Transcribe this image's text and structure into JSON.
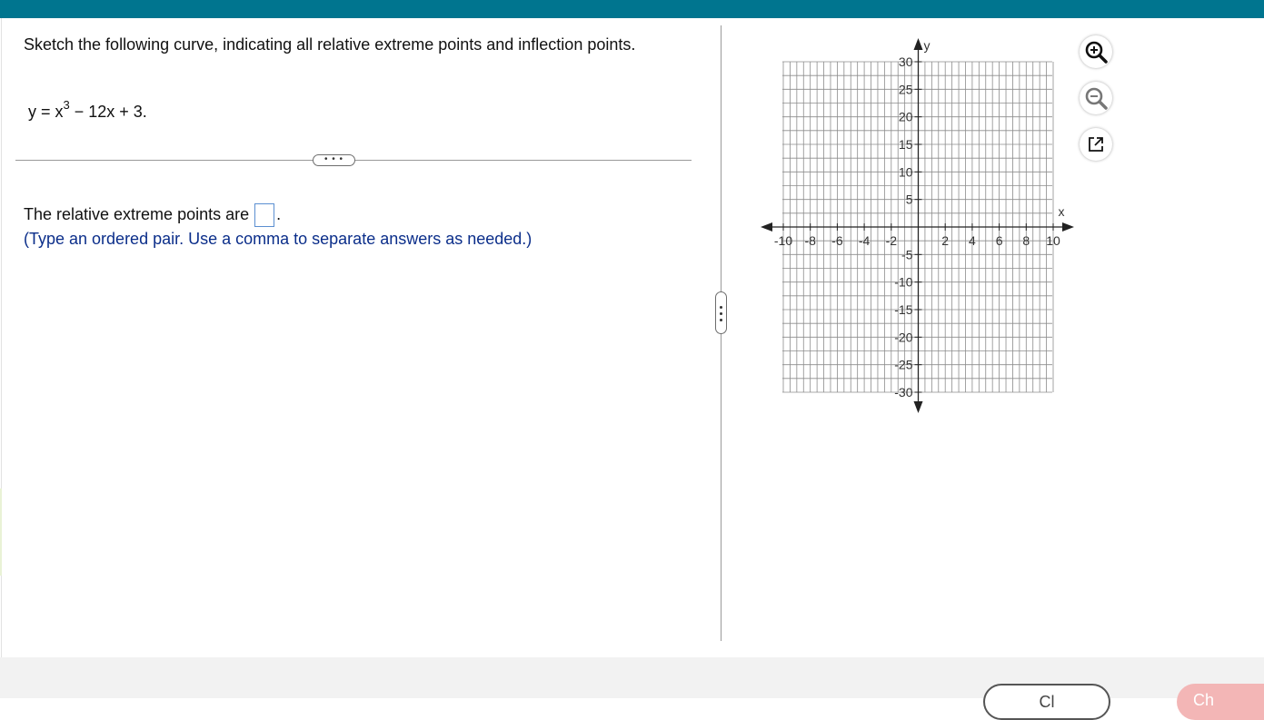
{
  "question": {
    "prompt": "Sketch the following curve, indicating all relative extreme points and inflection points.",
    "equation_prefix": "y = x",
    "equation_exp": "3",
    "equation_suffix": " − 12x + 3."
  },
  "expand_label": "• • •",
  "answer": {
    "label": "The relative extreme points are",
    "value": "",
    "after": ".",
    "hint": "(Type an ordered pair. Use a comma to separate answers as needed.)"
  },
  "graph": {
    "x_label": "x",
    "y_label": "y",
    "x_ticks": [
      "-10",
      "-8",
      "-6",
      "-4",
      "-2",
      "2",
      "4",
      "6",
      "8",
      "10"
    ],
    "y_ticks_pos": [
      "30",
      "25",
      "20",
      "15",
      "10",
      "5"
    ],
    "y_ticks_neg": [
      "-5",
      "-10",
      "-15",
      "-20",
      "-25",
      "-30"
    ],
    "xlim": [
      -10,
      10
    ],
    "ylim": [
      -30,
      30
    ]
  },
  "tools": {
    "zoom_in": "zoom-in-icon",
    "zoom_out": "zoom-out-icon",
    "popout": "popout-icon"
  },
  "colors": {
    "topbar": "#00758f",
    "hint": "#0b2e8a"
  },
  "footer": {
    "partial_text": "",
    "button1": "Cl",
    "button2": "Ch"
  }
}
